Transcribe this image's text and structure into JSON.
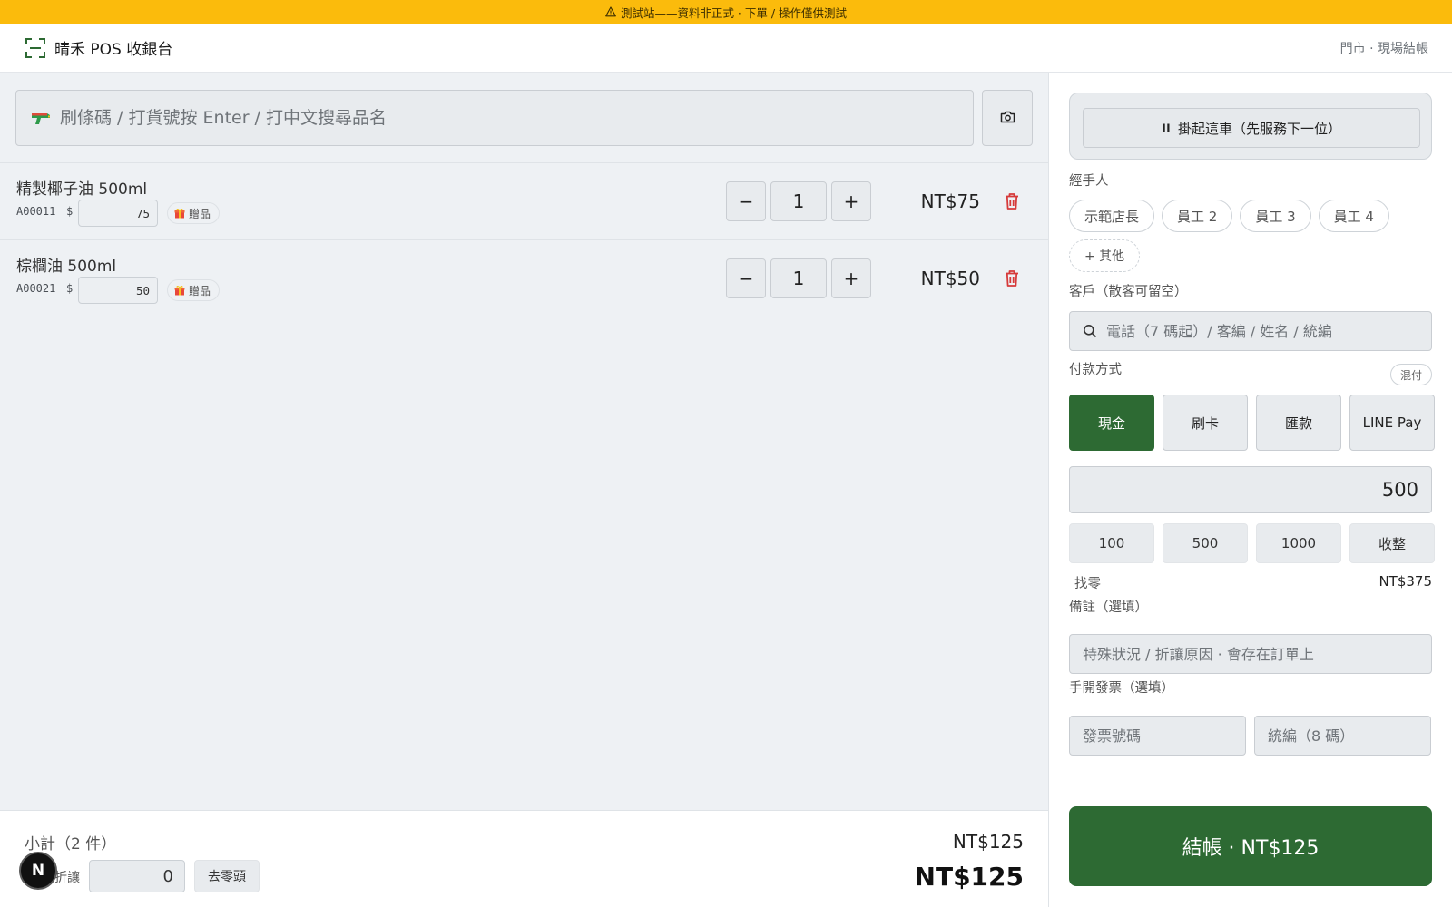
{
  "banner": {
    "text": "測試站——資料非正式 · 下單 / 操作僅供測試"
  },
  "header": {
    "title": "晴禾 POS 收銀台",
    "mode": "門市 · 現場結帳"
  },
  "search": {
    "placeholder": "刷條碼 / 打貨號按 Enter / 打中文搜尋品名"
  },
  "cart": {
    "items": [
      {
        "name": "精製椰子油 500ml",
        "sku": "A00011",
        "currency_symbol": "$",
        "unit_price": "75",
        "gift_label": "贈品",
        "qty": "1",
        "line_total": "NT$75"
      },
      {
        "name": "棕櫚油 500ml",
        "sku": "A00021",
        "currency_symbol": "$",
        "unit_price": "50",
        "gift_label": "贈品",
        "qty": "1",
        "line_total": "NT$50"
      }
    ],
    "minus_label": "−",
    "plus_label": "+"
  },
  "summary": {
    "subtotal_label": "小計（2 件）",
    "subtotal": "NT$125",
    "discount_label": "折讓",
    "discount_value": "0",
    "round_label": "去零頭",
    "total": "NT$125"
  },
  "sidebar": {
    "hold_label": "掛起這車（先服務下一位）",
    "staff_label": "經手人",
    "staff": [
      "示範店長",
      "員工 2",
      "員工 3",
      "員工 4"
    ],
    "staff_more": "+ 其他",
    "customer_label": "客戶（散客可留空）",
    "customer_placeholder": "電話（7 碼起）/ 客編 / 姓名 / 統編",
    "payment_label": "付款方式",
    "mixed_label": "混付",
    "payment_methods": [
      "現金",
      "刷卡",
      "匯款",
      "LINE Pay"
    ],
    "active_payment": "現金",
    "tendered": "500",
    "quick_amounts": [
      "100",
      "500",
      "1000",
      "收整"
    ],
    "change_label": "找零",
    "change_value": "NT$375",
    "memo_label": "備註（選填）",
    "memo_placeholder": "特殊狀況 / 折讓原因 · 會存在訂單上",
    "invoice_label": "手開發票（選填）",
    "invoice_no_placeholder": "發票號碼",
    "tax_id_placeholder": "統編（8 碼）",
    "checkout_label": "結帳 · NT$125"
  },
  "dev_badge": "N",
  "colors": {
    "banner": "#fbbb0c",
    "brand_green": "#2d6a33",
    "danger": "#d63a3a"
  }
}
